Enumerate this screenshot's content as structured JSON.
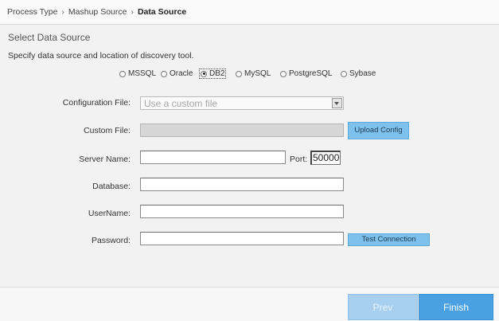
{
  "breadcrumb": {
    "items": [
      "Process Type",
      "Mashup Source"
    ],
    "current": "Data Source",
    "separator": "›"
  },
  "section": {
    "title": "Select Data Source",
    "description": "Specify data source and location of discovery tool."
  },
  "data_sources": {
    "options": [
      "MSSQL",
      "Oracle",
      "DB2",
      "MySQL",
      "PostgreSQL",
      "Sybase"
    ],
    "selected": "DB2"
  },
  "form": {
    "config_file_label": "Configuration File:",
    "config_file_value": "Use a custom file",
    "custom_file_label": "Custom File:",
    "upload_config_label": "Upload Config",
    "server_name_label": "Server Name:",
    "server_name_value": "",
    "port_label": "Port:",
    "port_value": "50000",
    "database_label": "Database:",
    "database_value": "",
    "username_label": "UserName:",
    "username_value": "",
    "password_label": "Password:",
    "password_value": "",
    "test_connection_label": "Test Connection"
  },
  "footer": {
    "prev_label": "Prev",
    "finish_label": "Finish"
  },
  "colors": {
    "button_light": "#7ec1ec",
    "prev_disabled": "#a9cfee",
    "finish": "#4aa0e0"
  }
}
